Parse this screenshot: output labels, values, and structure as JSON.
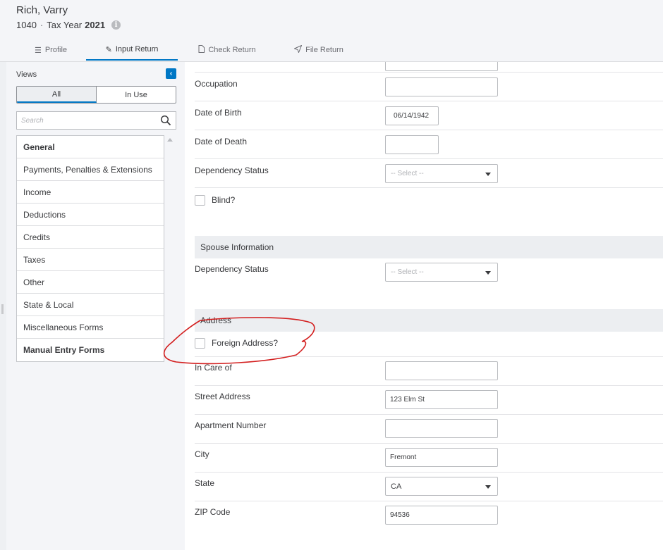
{
  "header": {
    "client_name": "Rich, Varry",
    "form": "1040",
    "separator": "·",
    "tax_year_label": "Tax Year",
    "tax_year": "2021",
    "info_icon": "info-icon"
  },
  "tabs": [
    {
      "label": "Profile",
      "icon": "list-icon"
    },
    {
      "label": "Input Return",
      "icon": "pencil-icon",
      "active": true
    },
    {
      "label": "Check Return",
      "icon": "document-icon"
    },
    {
      "label": "File Return",
      "icon": "paper-plane-icon"
    }
  ],
  "sidebar": {
    "views_label": "Views",
    "toggle_all": "All",
    "toggle_in_use": "In Use",
    "search_placeholder": "Search",
    "items": [
      {
        "label": "General",
        "bold": true
      },
      {
        "label": "Payments, Penalties & Extensions"
      },
      {
        "label": "Income"
      },
      {
        "label": "Deductions"
      },
      {
        "label": "Credits"
      },
      {
        "label": "Taxes"
      },
      {
        "label": "Other"
      },
      {
        "label": "State & Local"
      },
      {
        "label": "Miscellaneous Forms"
      },
      {
        "label": "Manual Entry Forms",
        "bold": true
      }
    ]
  },
  "form": {
    "occupation_label": "Occupation",
    "occupation_value": "",
    "dob_label": "Date of Birth",
    "dob_value": "06/14/1942",
    "dod_label": "Date of Death",
    "dod_value": "",
    "dependency_label": "Dependency Status",
    "dependency_value": "-- Select --",
    "blind_label": "Blind?",
    "spouse_section": "Spouse Information",
    "spouse_dependency_label": "Dependency Status",
    "spouse_dependency_value": "-- Select --",
    "address_section": "Address",
    "foreign_label": "Foreign Address?",
    "care_of_label": "In Care of",
    "care_of_value": "",
    "street_label": "Street Address",
    "street_value": "123 Elm St",
    "apt_label": "Apartment Number",
    "apt_value": "",
    "city_label": "City",
    "city_value": "Fremont",
    "state_label": "State",
    "state_value": "CA",
    "zip_label": "ZIP Code",
    "zip_value": "94536"
  },
  "colors": {
    "accent": "#0077c5",
    "annotation": "#d31f1f"
  }
}
